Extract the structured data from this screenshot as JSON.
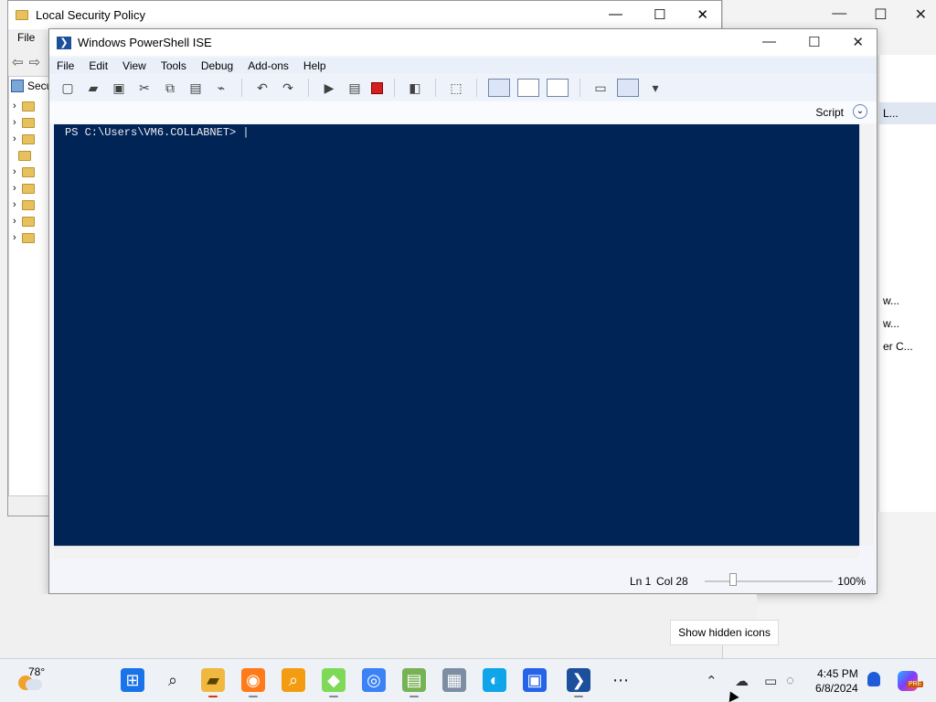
{
  "local_security_policy": {
    "title": "Local Security Policy",
    "menu_file": "File",
    "tree_root_label": "Secu",
    "controls": {
      "minimize": "—",
      "maximize": "☐",
      "close": "✕"
    }
  },
  "background_window": {
    "controls": {
      "minimize": "—",
      "maximize": "☐",
      "close": "✕"
    },
    "panel_items": [
      "L...",
      "w...",
      "w...",
      "er C..."
    ],
    "panel_close": "✕"
  },
  "ise": {
    "title": "Windows PowerShell ISE",
    "menu": [
      "File",
      "Edit",
      "View",
      "Tools",
      "Debug",
      "Add-ons",
      "Help"
    ],
    "script_label": "Script",
    "prompt": "PS C:\\Users\\VM6.COLLABNET>",
    "status": {
      "line": "Ln 1",
      "column": "Col 28",
      "zoom_percent": "100%"
    },
    "controls": {
      "minimize": "—",
      "maximize": "☐",
      "close": "✕"
    }
  },
  "tooltip": {
    "text": "Show hidden icons"
  },
  "taskbar": {
    "temperature": "78°",
    "time": "4:45 PM",
    "date": "6/8/2024",
    "copilot_badge": "PRE",
    "apps": [
      {
        "name": "start",
        "glyph": "⊞"
      },
      {
        "name": "search",
        "glyph": "⌕"
      },
      {
        "name": "file-explorer",
        "glyph": "▰"
      },
      {
        "name": "firefox",
        "glyph": "◉"
      },
      {
        "name": "search-app",
        "glyph": "⌕"
      },
      {
        "name": "app",
        "glyph": "◆"
      },
      {
        "name": "chrome",
        "glyph": "◎"
      },
      {
        "name": "chart-app",
        "glyph": "▤"
      },
      {
        "name": "calculator",
        "glyph": "▦"
      },
      {
        "name": "edge",
        "glyph": "◐"
      },
      {
        "name": "store",
        "glyph": "▣"
      },
      {
        "name": "powershell",
        "glyph": "❯"
      },
      {
        "name": "more",
        "glyph": "⋯"
      }
    ]
  }
}
